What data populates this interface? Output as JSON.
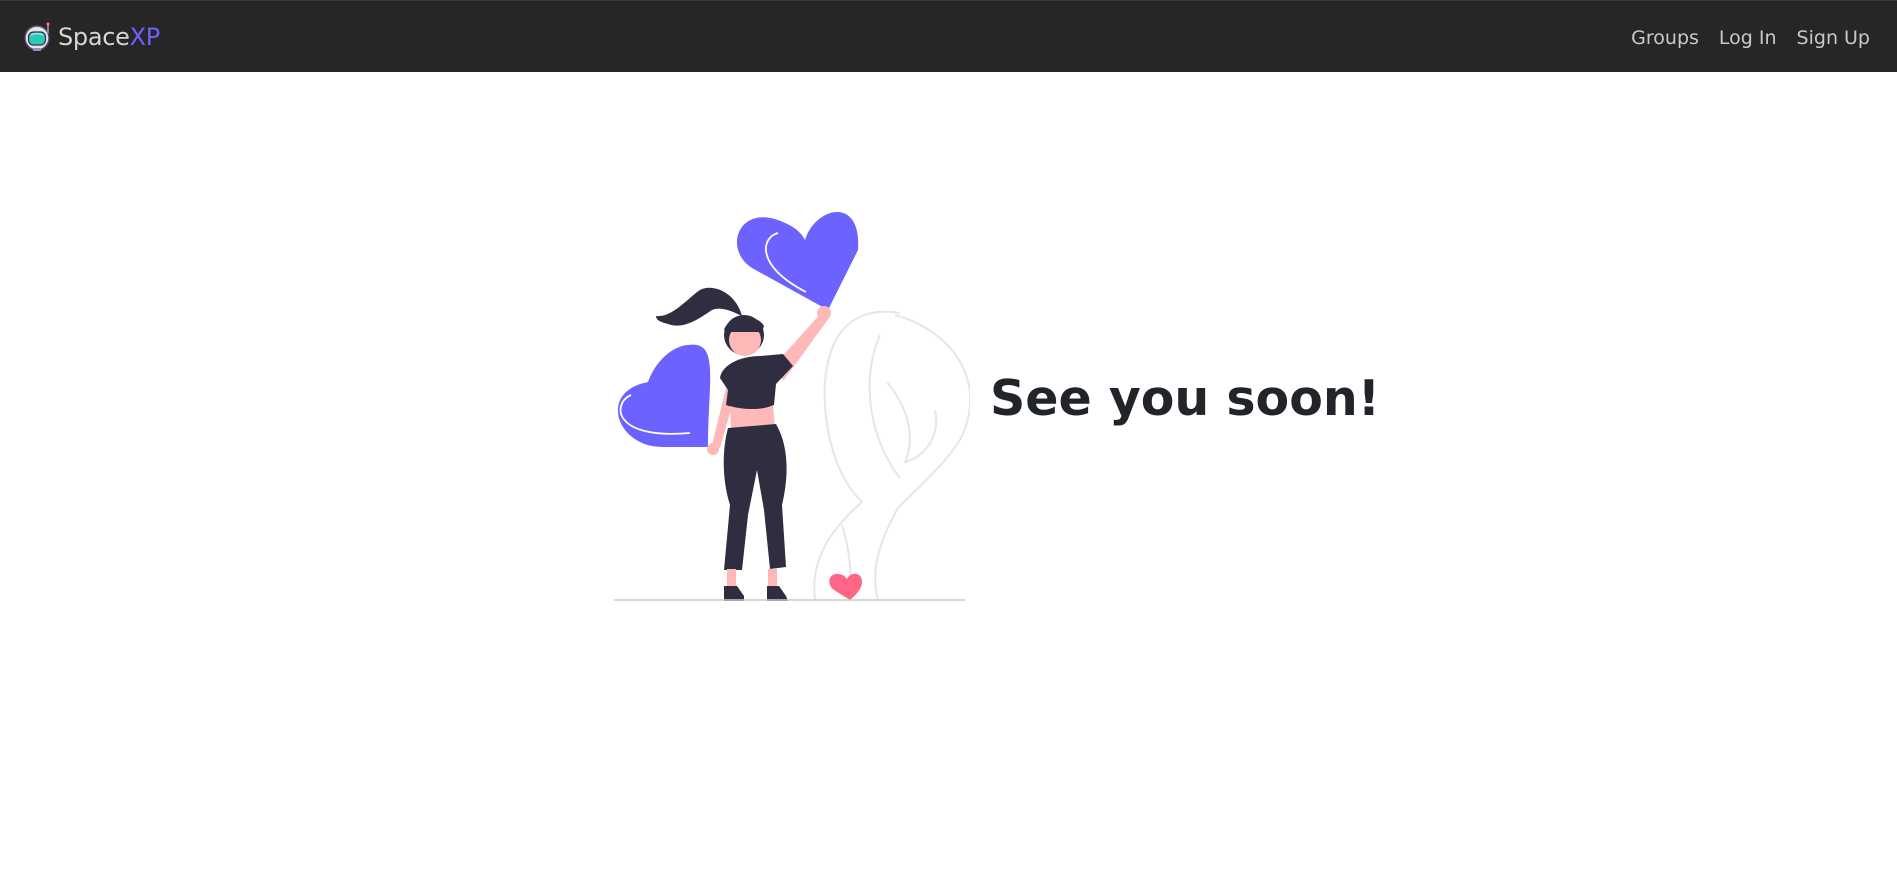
{
  "navbar": {
    "brand": {
      "name_main": "Space",
      "name_accent": "XP",
      "logo_icon": "astronaut-helmet-icon",
      "accent_color": "#6c63ff"
    },
    "links": [
      {
        "label": "Groups"
      },
      {
        "label": "Log In"
      },
      {
        "label": "Sign Up"
      }
    ],
    "background_color": "#262626"
  },
  "main": {
    "headline": "See you soon!",
    "illustration": {
      "icon": "woman-holding-hearts-illustration",
      "heart_color": "#6c63ff",
      "small_heart_color": "#ff6584"
    }
  }
}
